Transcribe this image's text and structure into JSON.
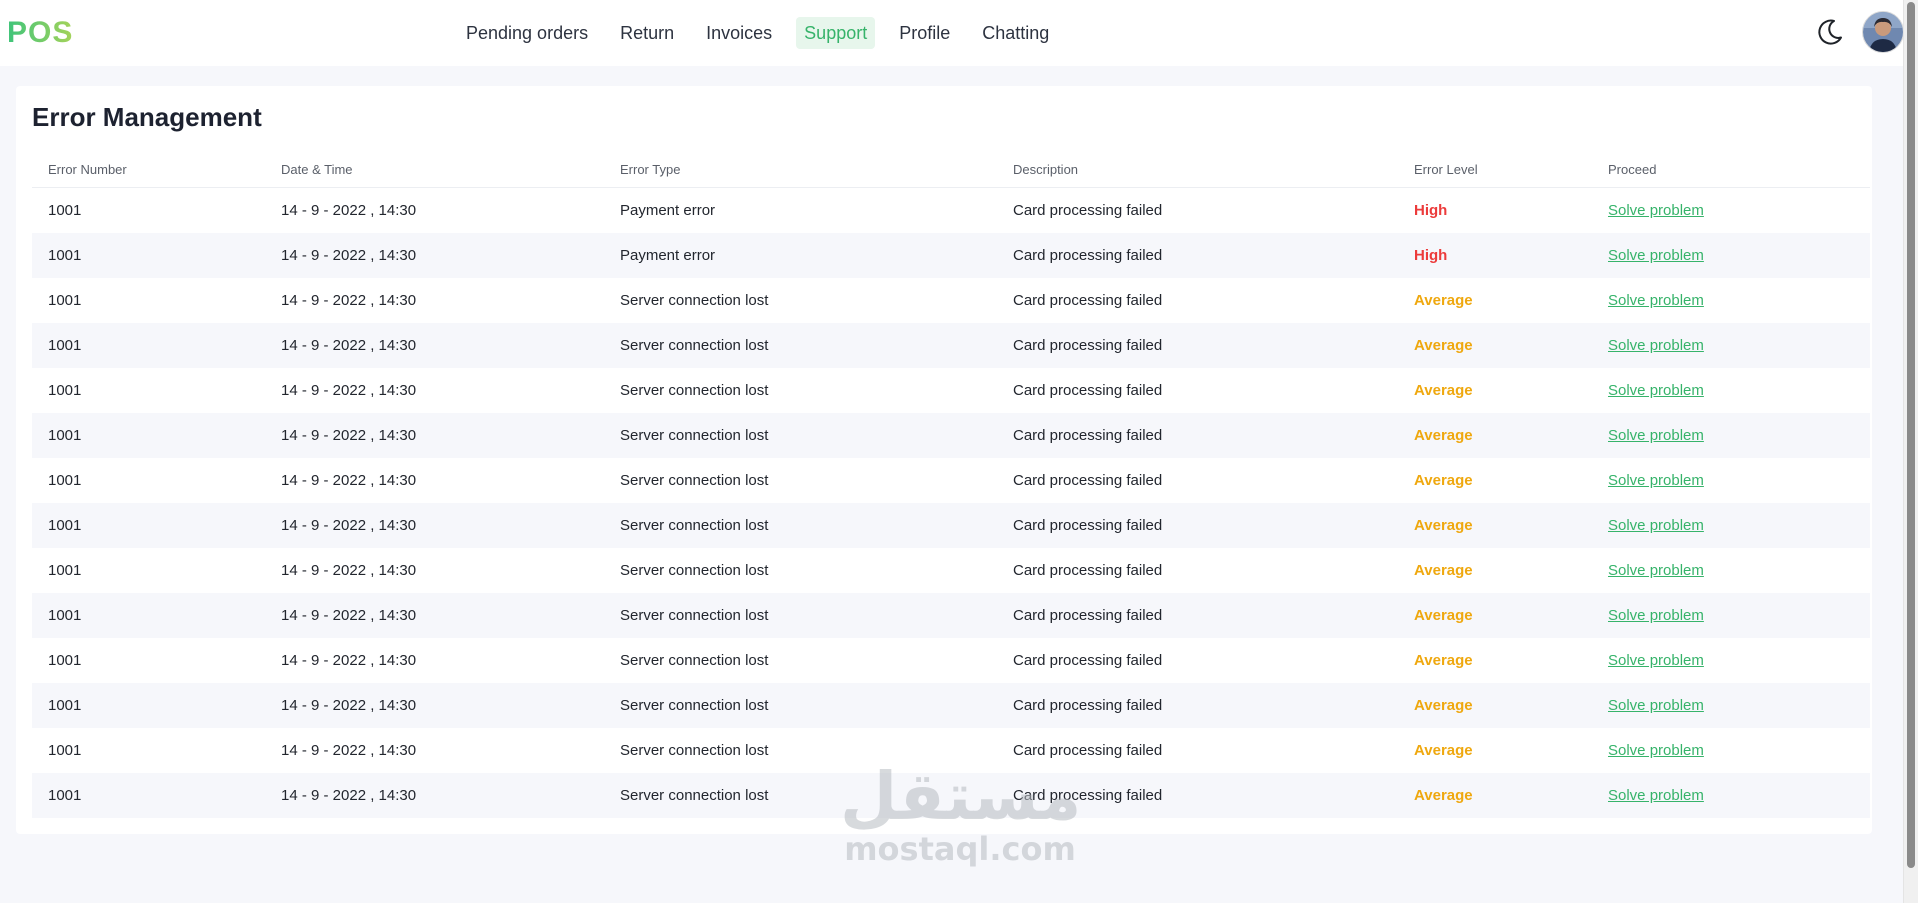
{
  "app": {
    "logo": "POS"
  },
  "nav": {
    "items": [
      {
        "label": "Pending orders"
      },
      {
        "label": "Return"
      },
      {
        "label": "Invoices"
      },
      {
        "label": "Support",
        "active": true
      },
      {
        "label": "Profile"
      },
      {
        "label": "Chatting"
      }
    ]
  },
  "header": {
    "theme_toggle_icon": "moon-icon",
    "avatar_icon": "user-avatar"
  },
  "page": {
    "title": "Error Management"
  },
  "table": {
    "columns": [
      "Error Number",
      "Date & Time",
      "Error Type",
      "Description",
      "Error Level",
      "Proceed"
    ],
    "rows": [
      {
        "number": "1001",
        "datetime": "14 - 9 - 2022 , 14:30",
        "type": "Payment error",
        "description": "Card processing failed",
        "level": "High",
        "action": "Solve problem"
      },
      {
        "number": "1001",
        "datetime": "14 - 9 - 2022 , 14:30",
        "type": "Payment error",
        "description": "Card processing failed",
        "level": "High",
        "action": "Solve problem"
      },
      {
        "number": "1001",
        "datetime": "14 - 9 - 2022 , 14:30",
        "type": "Server connection lost",
        "description": "Card processing failed",
        "level": "Average",
        "action": "Solve problem"
      },
      {
        "number": "1001",
        "datetime": "14 - 9 - 2022 , 14:30",
        "type": "Server connection lost",
        "description": "Card processing failed",
        "level": "Average",
        "action": "Solve problem"
      },
      {
        "number": "1001",
        "datetime": "14 - 9 - 2022 , 14:30",
        "type": "Server connection lost",
        "description": "Card processing failed",
        "level": "Average",
        "action": "Solve problem"
      },
      {
        "number": "1001",
        "datetime": "14 - 9 - 2022 , 14:30",
        "type": "Server connection lost",
        "description": "Card processing failed",
        "level": "Average",
        "action": "Solve problem"
      },
      {
        "number": "1001",
        "datetime": "14 - 9 - 2022 , 14:30",
        "type": "Server connection lost",
        "description": "Card processing failed",
        "level": "Average",
        "action": "Solve problem"
      },
      {
        "number": "1001",
        "datetime": "14 - 9 - 2022 , 14:30",
        "type": "Server connection lost",
        "description": "Card processing failed",
        "level": "Average",
        "action": "Solve problem"
      },
      {
        "number": "1001",
        "datetime": "14 - 9 - 2022 , 14:30",
        "type": "Server connection lost",
        "description": "Card processing failed",
        "level": "Average",
        "action": "Solve problem"
      },
      {
        "number": "1001",
        "datetime": "14 - 9 - 2022 , 14:30",
        "type": "Server connection lost",
        "description": "Card processing failed",
        "level": "Average",
        "action": "Solve problem"
      },
      {
        "number": "1001",
        "datetime": "14 - 9 - 2022 , 14:30",
        "type": "Server connection lost",
        "description": "Card processing failed",
        "level": "Average",
        "action": "Solve problem"
      },
      {
        "number": "1001",
        "datetime": "14 - 9 - 2022 , 14:30",
        "type": "Server connection lost",
        "description": "Card processing failed",
        "level": "Average",
        "action": "Solve problem"
      },
      {
        "number": "1001",
        "datetime": "14 - 9 - 2022 , 14:30",
        "type": "Server connection lost",
        "description": "Card processing failed",
        "level": "Average",
        "action": "Solve problem"
      },
      {
        "number": "1001",
        "datetime": "14 - 9 - 2022 , 14:30",
        "type": "Server connection lost",
        "description": "Card processing failed",
        "level": "Average",
        "action": "Solve problem"
      }
    ]
  },
  "colors": {
    "accent": "#36b36a",
    "high": "#ec3b3b",
    "average": "#efa80f"
  },
  "watermark": {
    "arabic": "مستقل",
    "latin": "mostaql.com"
  }
}
